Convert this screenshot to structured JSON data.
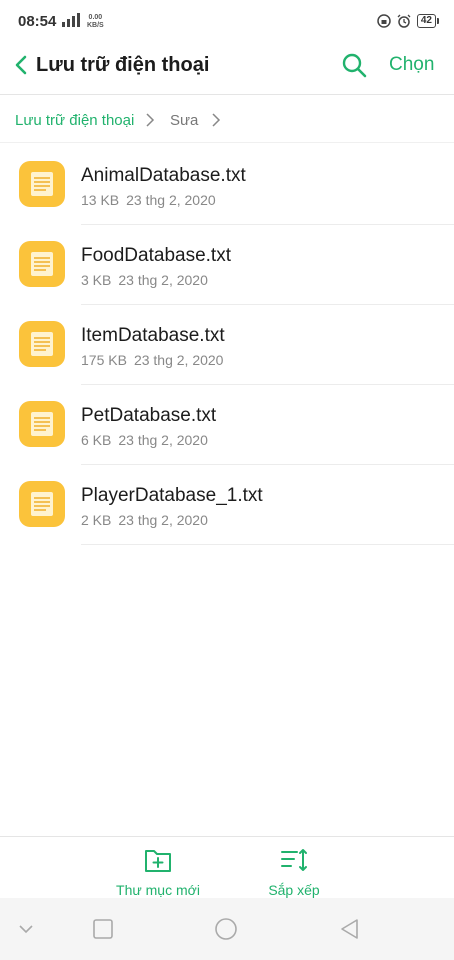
{
  "status": {
    "time": "08:54",
    "net_speed_value": "0.00",
    "net_speed_unit": "KB/S",
    "battery": "42"
  },
  "header": {
    "title": "Lưu trữ điện thoại",
    "select_label": "Chọn"
  },
  "breadcrumb": {
    "root": "Lưu trữ điện thoại",
    "current": "Sưa"
  },
  "files": [
    {
      "name": "AnimalDatabase.txt",
      "size": "13 KB",
      "date": "23 thg 2, 2020"
    },
    {
      "name": "FoodDatabase.txt",
      "size": "3 KB",
      "date": "23 thg 2, 2020"
    },
    {
      "name": "ItemDatabase.txt",
      "size": "175 KB",
      "date": "23 thg 2, 2020"
    },
    {
      "name": "PetDatabase.txt",
      "size": "6 KB",
      "date": "23 thg 2, 2020"
    },
    {
      "name": "PlayerDatabase_1.txt",
      "size": "2 KB",
      "date": "23 thg 2, 2020"
    }
  ],
  "toolbar": {
    "new_folder_label": "Thư mục mới",
    "sort_label": "Sắp xếp"
  },
  "colors": {
    "accent": "#21b26d",
    "file_icon": "#fbc33b"
  },
  "icons": {
    "back": "chevron-left-icon",
    "search": "search-icon",
    "file": "text-file-icon",
    "new_folder": "folder-plus-icon",
    "sort": "sort-icon"
  }
}
